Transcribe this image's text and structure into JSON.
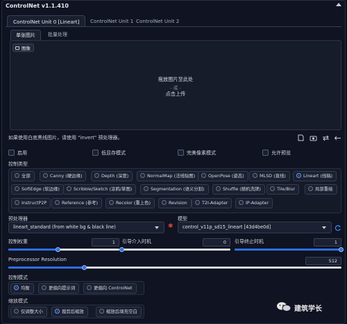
{
  "header": {
    "title": "ControlNet v1.1.410"
  },
  "unit_tabs": [
    {
      "label": "ControlNet Unit 0 [Lineart]"
    },
    {
      "label": "ControlNet Unit 1"
    },
    {
      "label": "ControlNet Unit 2"
    }
  ],
  "image_tabs": [
    {
      "label": "单张图片"
    },
    {
      "label": "批量处理"
    }
  ],
  "dropzone": {
    "image_label": "图像",
    "line1": "拖放图片至此处",
    "or": "- 或 -",
    "line2": "点击上传"
  },
  "note": "如果使用白底黑线图片，请使用 \"invert\" 预处理器。",
  "tool_icons": [
    "document-icon",
    "camera-icon",
    "swap-icon",
    "back-arrow-icon"
  ],
  "checkboxes": {
    "enable": "启用",
    "low_vram": "低显存模式",
    "pixel_perfect": "完美像素模式",
    "allow_preview": "允许预览"
  },
  "control_type": {
    "label": "控制类型",
    "selected": "Lineart (线稿)",
    "rows": [
      [
        "全部",
        "Canny (硬边缘)",
        "Depth (深度)",
        "NormalMap (法线贴图)",
        "OpenPose (姿态)",
        "MLSD (直线)",
        "Lineart (线稿)"
      ],
      [
        "SoftEdge (软边缘)",
        "Scribble/Sketch (涂鸦/草图)",
        "Segmentation (语义分割)",
        "Shuffle (随机洗牌)",
        "Tile/Blur",
        "局部重绘"
      ],
      [
        "InstructP2P",
        "Reference (参考)",
        "Recolor (重上色)",
        "Revision",
        "T2I-Adapter",
        "IP-Adapter"
      ]
    ]
  },
  "preprocessor": {
    "label": "预处理器",
    "value": "lineart_standard (from white bg & black line)",
    "explode_icon": "fire-icon"
  },
  "model": {
    "label": "模型",
    "value": "control_v11p_sd15_lineart [43d4be0d]",
    "refresh_icon": "refresh-icon"
  },
  "sliders": {
    "weight": {
      "label": "控制权重",
      "value": "1",
      "fraction": 0.45
    },
    "start": {
      "label": "引导介入时机",
      "value": "0",
      "fraction": 0.0
    },
    "end": {
      "label": "引导终止时机",
      "value": "1",
      "fraction": 1.0
    },
    "resolution": {
      "label": "Preprocessor Resolution",
      "value": "512",
      "fraction": 0.23
    }
  },
  "control_mode": {
    "label": "控制模式",
    "options": [
      "均衡",
      "更偏向提示词",
      "更偏向 ControlNet"
    ],
    "selected": "均衡"
  },
  "resize_mode": {
    "label": "缩放模式",
    "options": [
      "仅调整大小",
      "裁剪后缩放",
      "缩放后填充空白"
    ],
    "selected": "裁剪后缩放"
  },
  "watermark": {
    "text": "建筑学长"
  },
  "colors": {
    "accent": "#2f6fe0",
    "background": "#0b0f19",
    "panel": "#0f1322"
  }
}
